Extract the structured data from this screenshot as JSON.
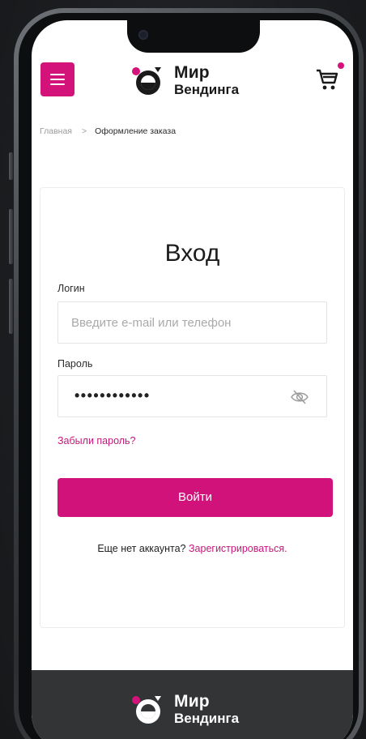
{
  "header": {
    "brand_line1": "Мир",
    "brand_line2": "Вендинга"
  },
  "breadcrumb": {
    "home": "Главная",
    "separator": ">",
    "current": "Оформление заказа"
  },
  "login_form": {
    "title": "Вход",
    "login_label": "Логин",
    "login_placeholder": "Введите e-mail или телефон",
    "password_label": "Пароль",
    "password_value": "••••••••••••",
    "forgot_link": "Забыли пароль?",
    "submit_label": "Войти",
    "signup_prompt": "Еще нет аккаунта?",
    "signup_link": "Зарегистрироваться."
  },
  "footer": {
    "brand_line1": "Мир",
    "brand_line2": "Вендинга"
  },
  "icons": {
    "menu": "menu-icon",
    "cart": "cart-icon",
    "password_toggle": "eye-off-icon"
  },
  "colors": {
    "accent": "#d4137a",
    "footer_bg": "#333436"
  }
}
